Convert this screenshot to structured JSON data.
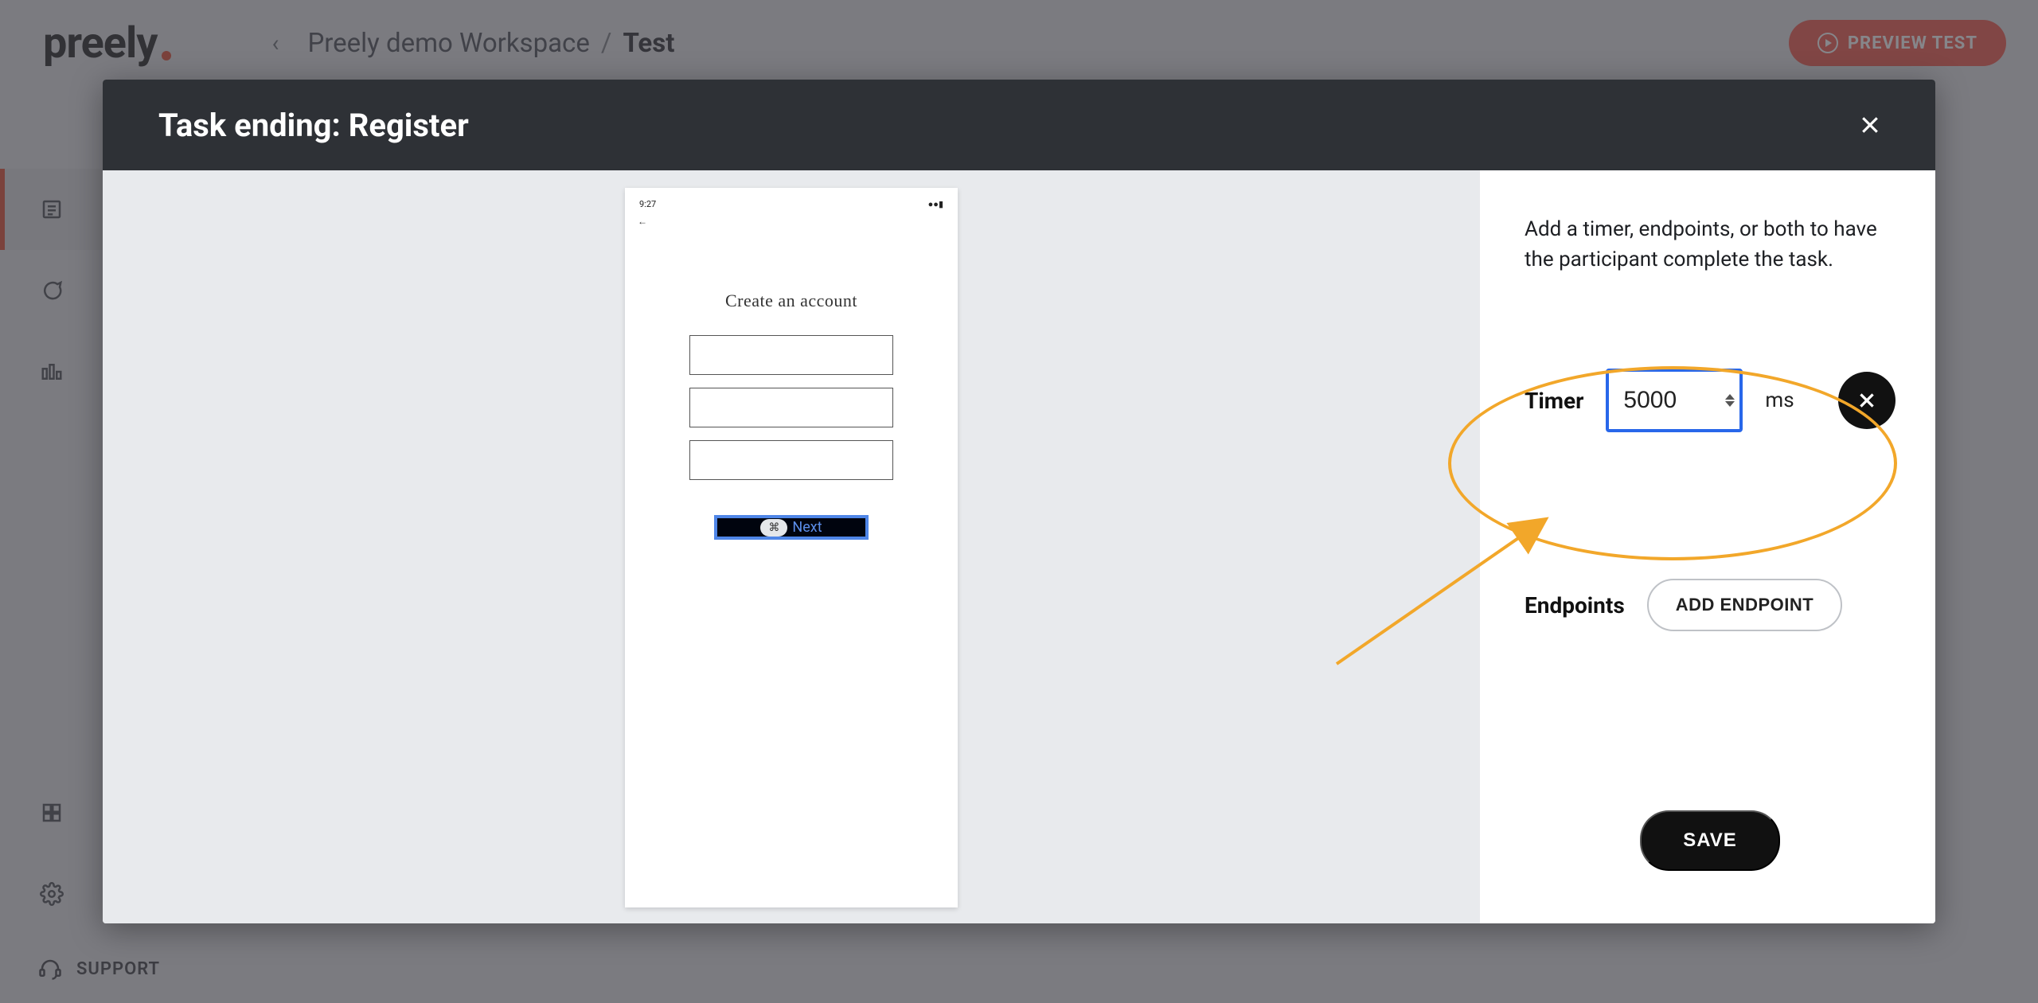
{
  "logo": "preely",
  "breadcrumb": {
    "workspace": "Preely demo Workspace",
    "current": "Test"
  },
  "preview_button": "PREVIEW TEST",
  "support_label": "SUPPORT",
  "modal": {
    "title": "Task ending: Register",
    "description": "Add a timer, endpoints, or both to have the participant complete the task.",
    "timer_label": "Timer",
    "timer_value": "5000",
    "timer_unit": "ms",
    "endpoints_label": "Endpoints",
    "add_endpoint": "ADD ENDPOINT",
    "save": "SAVE"
  },
  "phone": {
    "time": "9:27",
    "heading": "Create an account",
    "next": "Next"
  }
}
